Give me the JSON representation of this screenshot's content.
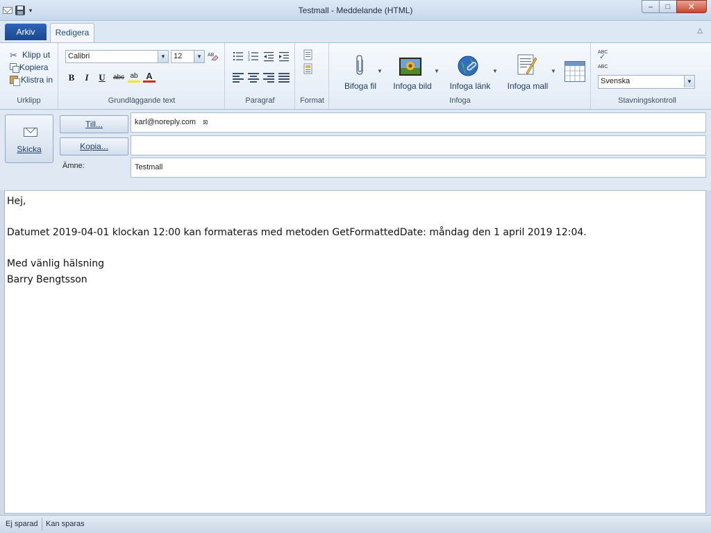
{
  "window": {
    "title": "Testmall - Meddelande (HTML)",
    "controls": {
      "minimize": "–",
      "maximize": "□",
      "close": "✕"
    }
  },
  "qat": {
    "more": "▾"
  },
  "tabs": {
    "file": "Arkiv",
    "edit": "Redigera",
    "collapse": "△"
  },
  "ribbon": {
    "clipboard": {
      "cut": "Klipp ut",
      "copy": "Kopiera",
      "paste": "Klistra in",
      "label": "Urklipp"
    },
    "basic_text": {
      "font": "Calibri",
      "size": "12",
      "bold": "B",
      "italic": "I",
      "underline": "U",
      "strike": "abc",
      "highlight": "ab",
      "font_color": "A",
      "label": "Grundläggande text"
    },
    "paragraph": {
      "label": "Paragraf"
    },
    "format": {
      "label": "Format"
    },
    "insert": {
      "attach": "Bifoga fil",
      "picture": "Infoga bild",
      "link": "Infoga länk",
      "template": "Infoga mall",
      "label": "Infoga"
    },
    "spelling": {
      "abc_top": "ABC",
      "abc_bottom": "ABC",
      "language": "Svenska",
      "label": "Stavningskontroll"
    }
  },
  "header": {
    "send": "Skicka",
    "to_button": "Till...",
    "cc_button": "Kopia...",
    "subject_label": "Ämne:",
    "to_value": "karl@noreply.com",
    "to_remove": "⊠",
    "cc_value": "",
    "subject_value": "Testmall"
  },
  "body": {
    "lines": [
      "Hej,",
      "",
      "Datumet 2019-04-01 klockan 12:00 kan formateras med metoden GetFormattedDate: måndag den 1 april 2019 12:04.",
      "",
      "Med vänlig hälsning",
      "Barry Bengtsson"
    ]
  },
  "status": {
    "left": "Ej sparad",
    "right": "Kan sparas"
  }
}
